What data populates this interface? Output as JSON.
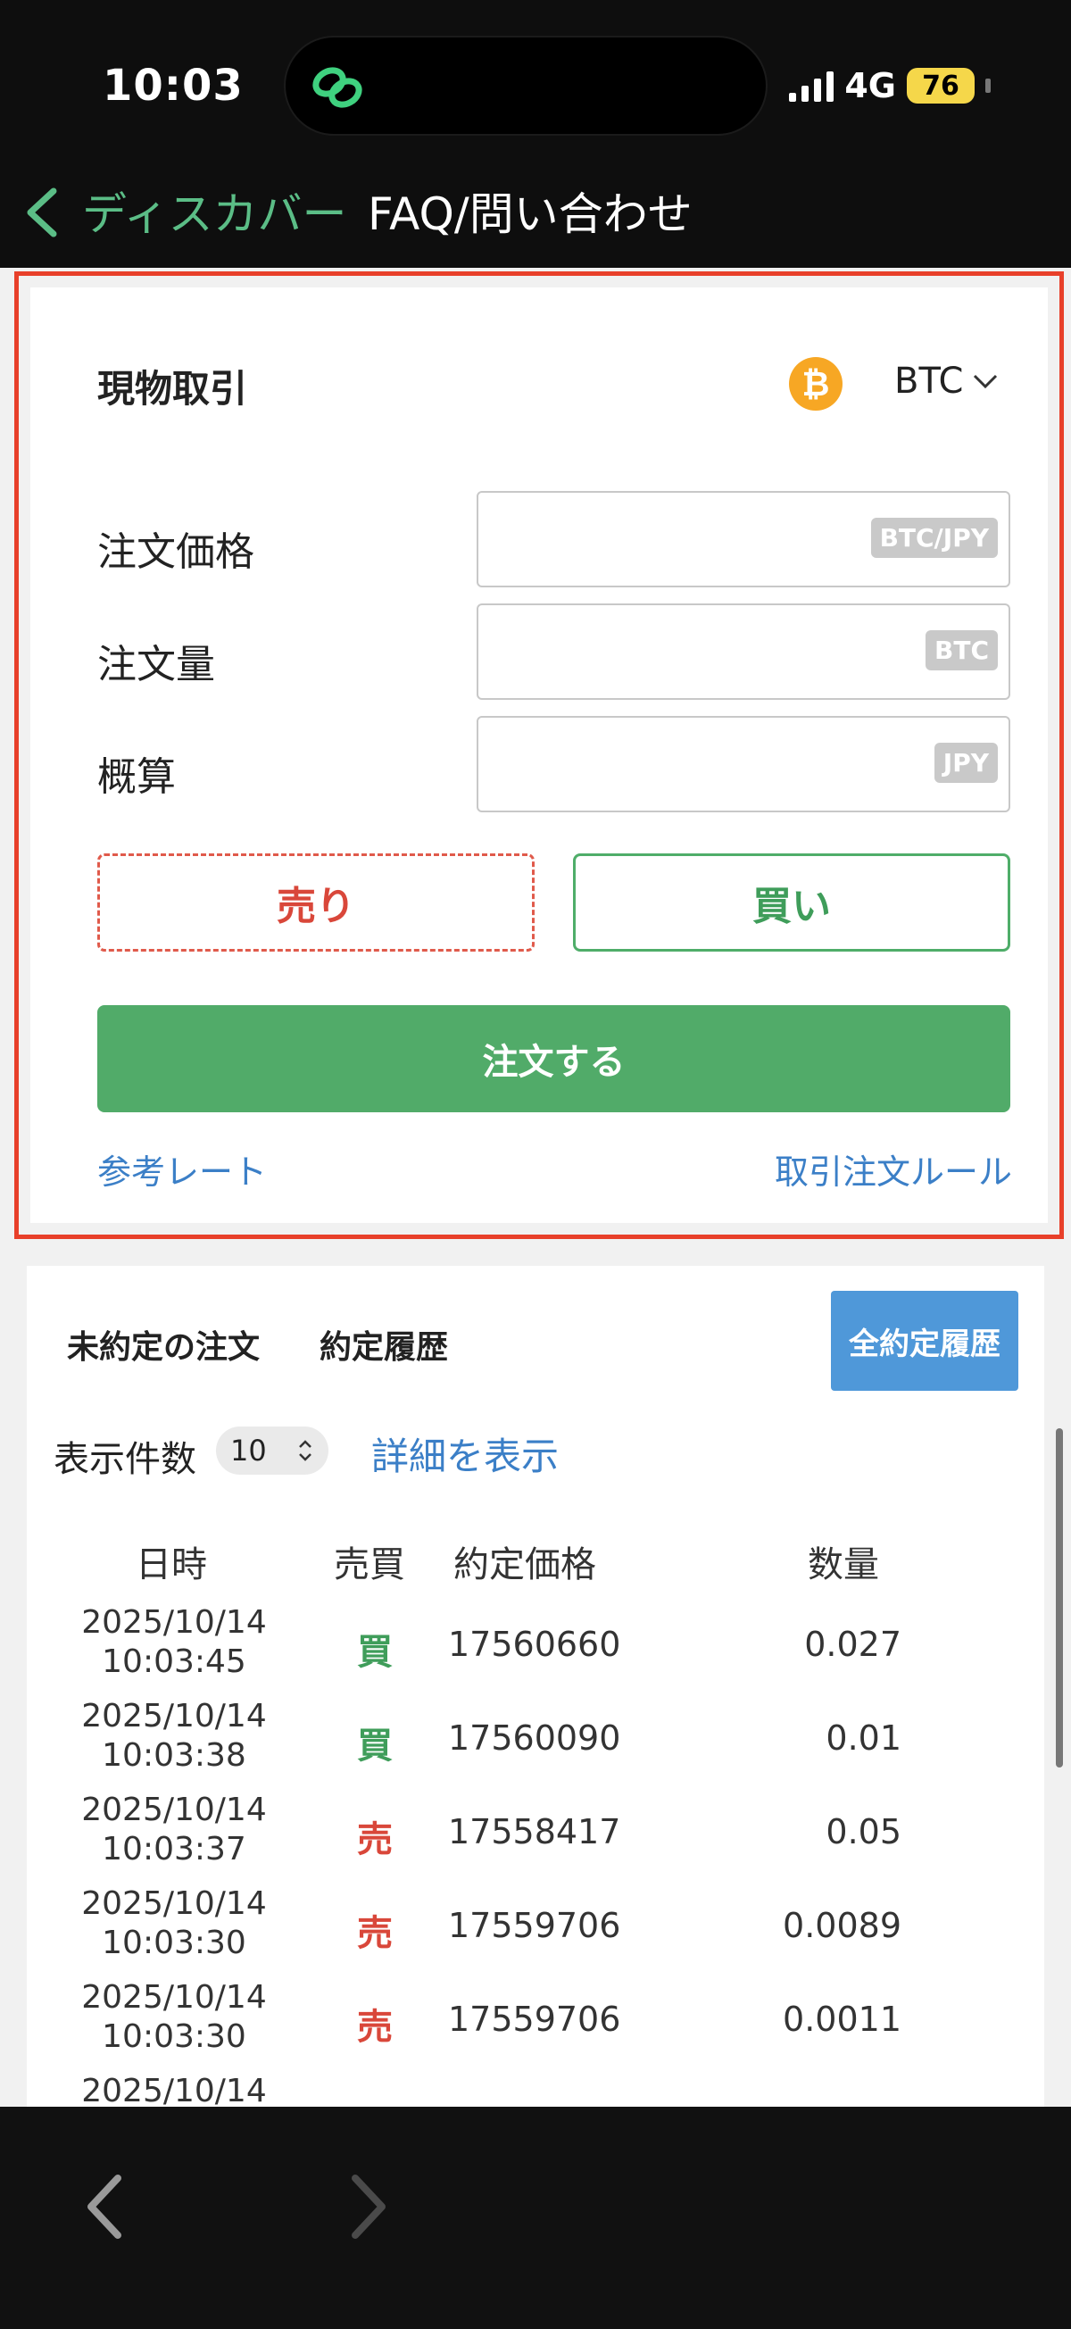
{
  "status_bar": {
    "time": "10:03",
    "network": "4G",
    "battery": "76",
    "island_icon": "link-app-icon"
  },
  "nav": {
    "back_label": "ディスカバー",
    "title": "FAQ/問い合わせ"
  },
  "trade": {
    "title": "現物取引",
    "coin_icon": "bitcoin-icon",
    "coin_symbol": "BTC",
    "fields": [
      {
        "label": "注文価格",
        "unit": "BTC/JPY",
        "value": ""
      },
      {
        "label": "注文量",
        "unit": "BTC",
        "value": ""
      },
      {
        "label": "概算",
        "unit": "JPY",
        "value": ""
      }
    ],
    "sell_label": "売り",
    "buy_label": "買い",
    "order_label": "注文する",
    "ref_rate_link": "参考レート",
    "rules_link": "取引注文ルール",
    "colors": {
      "highlight": "#e8402a",
      "buy": "#51ab69",
      "sell": "#d9473a",
      "link": "#3b7fc7"
    }
  },
  "history": {
    "tabs": [
      "未約定の注文",
      "約定履歴"
    ],
    "all_history_button": "全約定履歴",
    "count_label": "表示件数",
    "count_value": "10",
    "detail_link": "詳細を表示",
    "columns": [
      "日時",
      "売買",
      "約定価格",
      "数量"
    ],
    "rows": [
      {
        "date": "2025/10/14",
        "time": "10:03:45",
        "side": "買",
        "price": "17560660",
        "qty": "0.027"
      },
      {
        "date": "2025/10/14",
        "time": "10:03:38",
        "side": "買",
        "price": "17560090",
        "qty": "0.01"
      },
      {
        "date": "2025/10/14",
        "time": "10:03:37",
        "side": "売",
        "price": "17558417",
        "qty": "0.05"
      },
      {
        "date": "2025/10/14",
        "time": "10:03:30",
        "side": "売",
        "price": "17559706",
        "qty": "0.0089"
      },
      {
        "date": "2025/10/14",
        "time": "10:03:30",
        "side": "売",
        "price": "17559706",
        "qty": "0.0011"
      },
      {
        "date": "2025/10/14",
        "time": "",
        "side": "",
        "price": "",
        "qty": ""
      }
    ]
  }
}
